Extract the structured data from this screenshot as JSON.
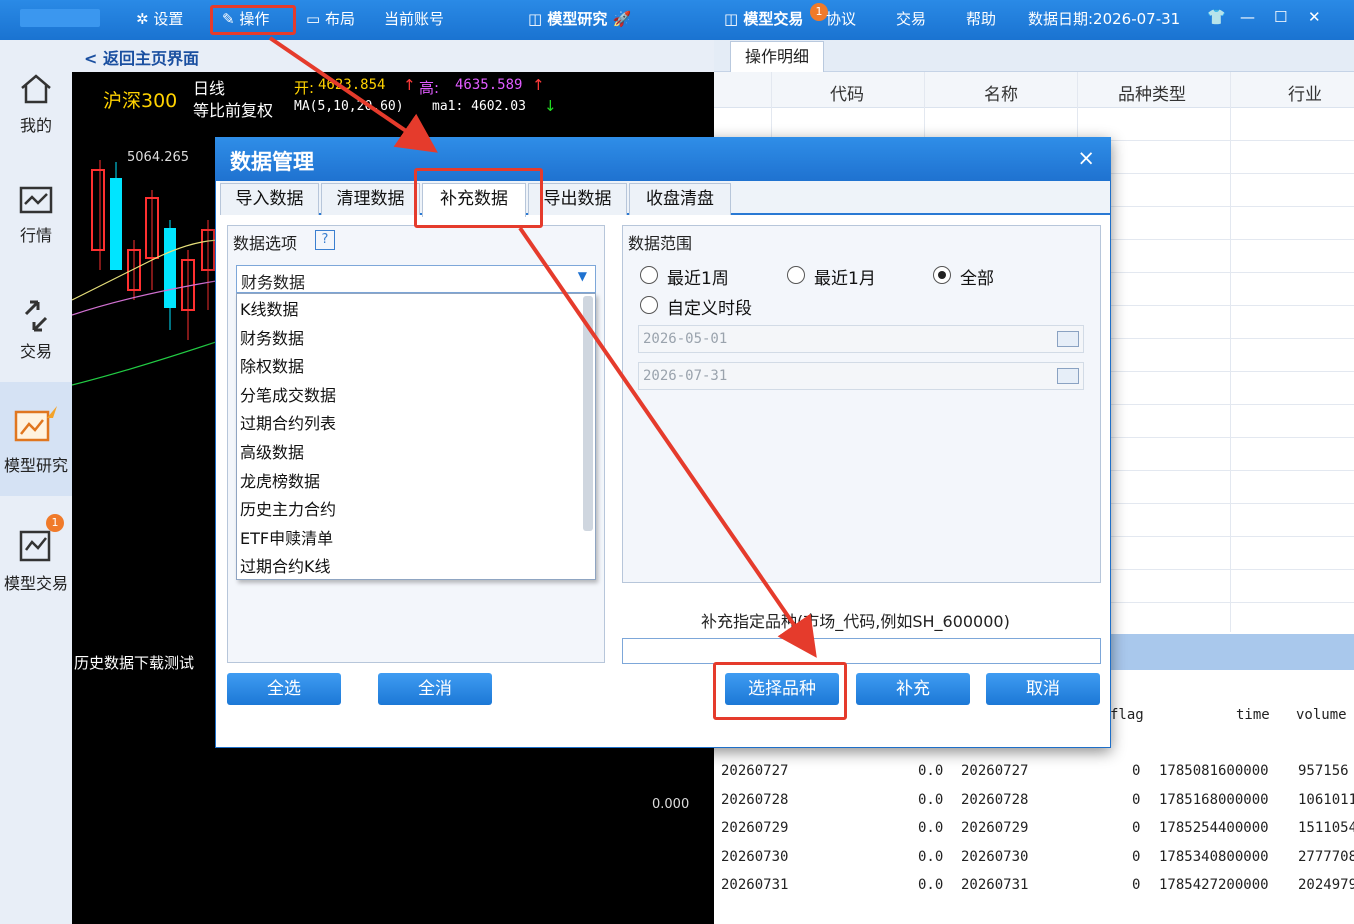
{
  "topbar": {
    "settings": "设置",
    "operate": "操作",
    "layout": "布局",
    "account": "当前账号",
    "model_research": "模型研究",
    "model_trade": "模型交易",
    "badge": "1",
    "protocol": "协议",
    "trade": "交易",
    "help": "帮助",
    "data_date": "数据日期:2026-07-31"
  },
  "sidebar": {
    "items": [
      {
        "label": "我的",
        "icon": "home-icon"
      },
      {
        "label": "行情",
        "icon": "chart-icon"
      },
      {
        "label": "交易",
        "icon": "trade-icon"
      },
      {
        "label": "模型研究",
        "icon": "model-research-icon"
      },
      {
        "label": "模型交易",
        "icon": "model-trade-icon",
        "badge": "1"
      }
    ]
  },
  "chart": {
    "back": "< 返回主页界面",
    "index_name": "沪深300",
    "period": "日线",
    "adjust": "等比前复权",
    "open_label": "开:",
    "open_value": "4623.854",
    "high_label": "高:",
    "high_value": "4635.589",
    "ma_label": "MA(5,10,20,60)",
    "ma1": "ma1: 4602.03",
    "peak_value": "5064.265",
    "zero_value": "0.000",
    "bottom_text": "历史数据下载测试"
  },
  "right_panel": {
    "tab": "操作明细",
    "columns": [
      "代码",
      "名称",
      "品种类型",
      "行业"
    ],
    "log_headers": {
      "flag": "flag",
      "time": "time",
      "volume": "volume"
    },
    "log_rows": [
      [
        "20260727",
        "0.0",
        "20260727",
        "0",
        "1785081600000",
        "957156"
      ],
      [
        "20260728",
        "0.0",
        "20260728",
        "0",
        "1785168000000",
        "1061011"
      ],
      [
        "20260729",
        "0.0",
        "20260729",
        "0",
        "1785254400000",
        "1511054"
      ],
      [
        "20260730",
        "0.0",
        "20260730",
        "0",
        "1785340800000",
        "2777708"
      ],
      [
        "20260731",
        "0.0",
        "20260731",
        "0",
        "1785427200000",
        "2024979"
      ]
    ]
  },
  "dialog": {
    "title": "数据管理",
    "close": "×",
    "tabs": [
      "导入数据",
      "清理数据",
      "补充数据",
      "导出数据",
      "收盘清盘"
    ],
    "selected_tab": "补充数据",
    "options_title": "数据选项",
    "help_mark": "?",
    "selected_option": "财务数据",
    "options": [
      "K线数据",
      "财务数据",
      "除权数据",
      "分笔成交数据",
      "过期合约列表",
      "高级数据",
      "龙虎榜数据",
      "历史主力合约",
      "ETF申赎清单",
      "过期合约K线"
    ],
    "range_title": "数据范围",
    "range_options": [
      "最近1周",
      "最近1月",
      "全部",
      "自定义时段"
    ],
    "range_selected": "全部",
    "date_start": "2026-05-01",
    "date_end": "2026-07-31",
    "spec_label": "补充指定品种(市场_代码,例如SH_600000)",
    "buttons": {
      "select_all": "全选",
      "deselect_all": "全消",
      "choose": "选择品种",
      "supplement": "补充",
      "cancel": "取消"
    }
  },
  "colors": {
    "accent": "#1f78d6",
    "highlight": "#e53b2c",
    "up": "#ff4040",
    "down": "#00e5ff"
  }
}
